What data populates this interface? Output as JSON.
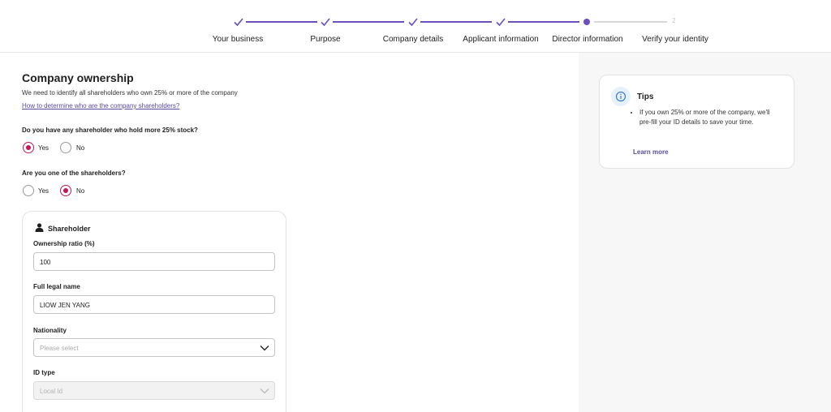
{
  "stepper": {
    "steps": [
      {
        "label": "Your business",
        "status": "done"
      },
      {
        "label": "Purpose",
        "status": "done"
      },
      {
        "label": "Company details",
        "status": "done"
      },
      {
        "label": "Applicant information",
        "status": "done"
      },
      {
        "label": "Director information",
        "status": "current"
      },
      {
        "label": "Verify your identity",
        "status": "pending",
        "number": "2"
      }
    ],
    "accent_color": "#6b4fbb"
  },
  "form": {
    "title": "Company ownership",
    "subtitle": "We need to identify all shareholders who own 25% or more of the company",
    "help_link": "How to determine who are the company shareholders?",
    "q1": {
      "text": "Do you have any shareholder who hold more 25% stock?",
      "yes": "Yes",
      "no": "No",
      "selected": "Yes"
    },
    "q2": {
      "text": "Are you one of the shareholders?",
      "yes": "Yes",
      "no": "No",
      "selected": "No"
    },
    "radio_color": "#c2185b"
  },
  "shareholder": {
    "title": "Shareholder",
    "icon": "person-icon",
    "ownership_label": "Ownership ratio (%)",
    "ownership_value": "100",
    "name_label": "Full legal name",
    "name_value": "LIOW JEN YANG",
    "nationality_label": "Nationality",
    "nationality_placeholder": "Please select",
    "id_type_label": "ID type",
    "id_type_value": "Local Id"
  },
  "tips": {
    "title": "Tips",
    "icon": "info-icon",
    "text": "If you own 25% or more of the company, we'll pre-fill your ID details to save your time.",
    "link": "Learn more"
  }
}
